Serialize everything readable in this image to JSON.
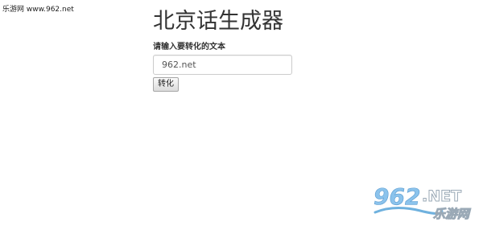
{
  "watermark": {
    "text": "乐游网 www.962.net"
  },
  "form": {
    "title": "北京话生成器",
    "label": "请输入要转化的文本",
    "input_value": "962.net",
    "button_label": "转化"
  },
  "logo": {
    "number": "962",
    "suffix": ".NET",
    "name": "乐游网",
    "number_color": "#8bc3ec",
    "suffix_color": "#ffffff",
    "name_color": "#ffffff"
  }
}
